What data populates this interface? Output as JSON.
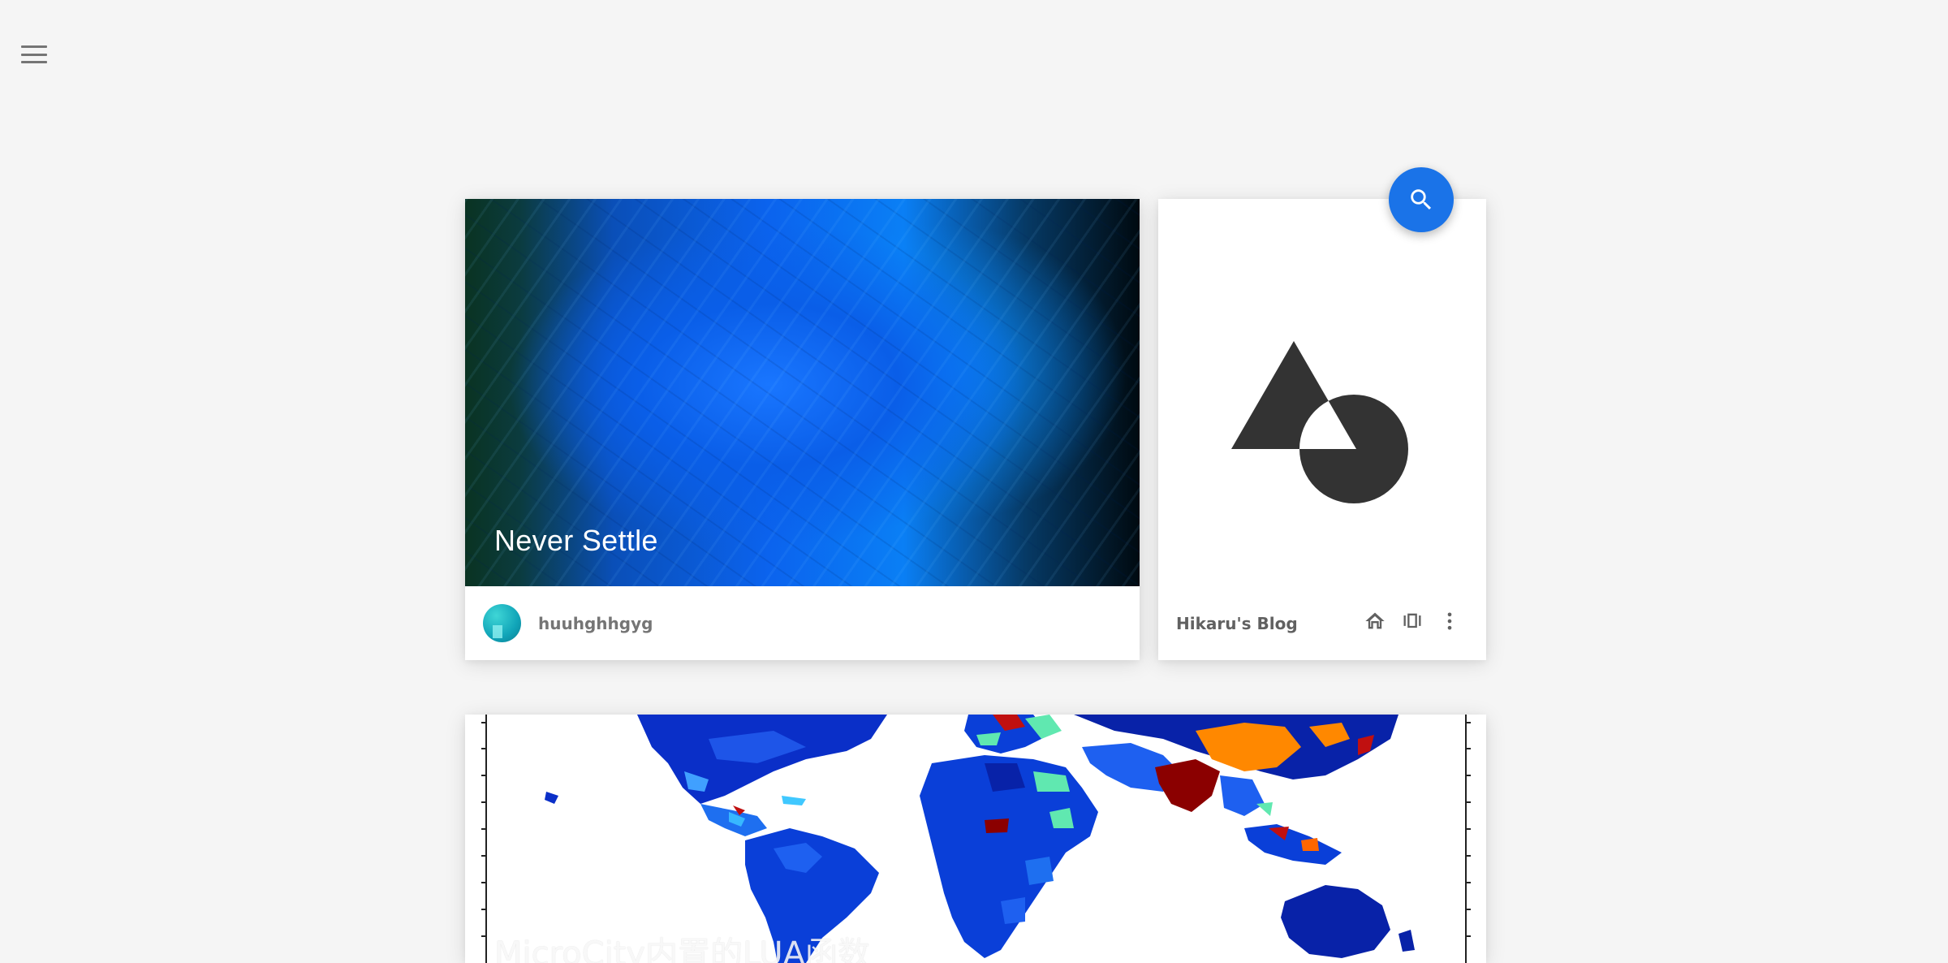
{
  "nav": {
    "menu_icon": "hamburger-menu-icon"
  },
  "search": {
    "icon": "search-icon",
    "color": "#1a73e8"
  },
  "featured_post": {
    "title": "Never Settle",
    "author": "huuhghhgyg"
  },
  "blog_card": {
    "name": "Hikaru's Blog",
    "icons": [
      "home-icon",
      "view-carousel-icon",
      "more-vert-icon"
    ]
  },
  "second_post": {
    "title": "MicroCity内置的LUA函数"
  }
}
